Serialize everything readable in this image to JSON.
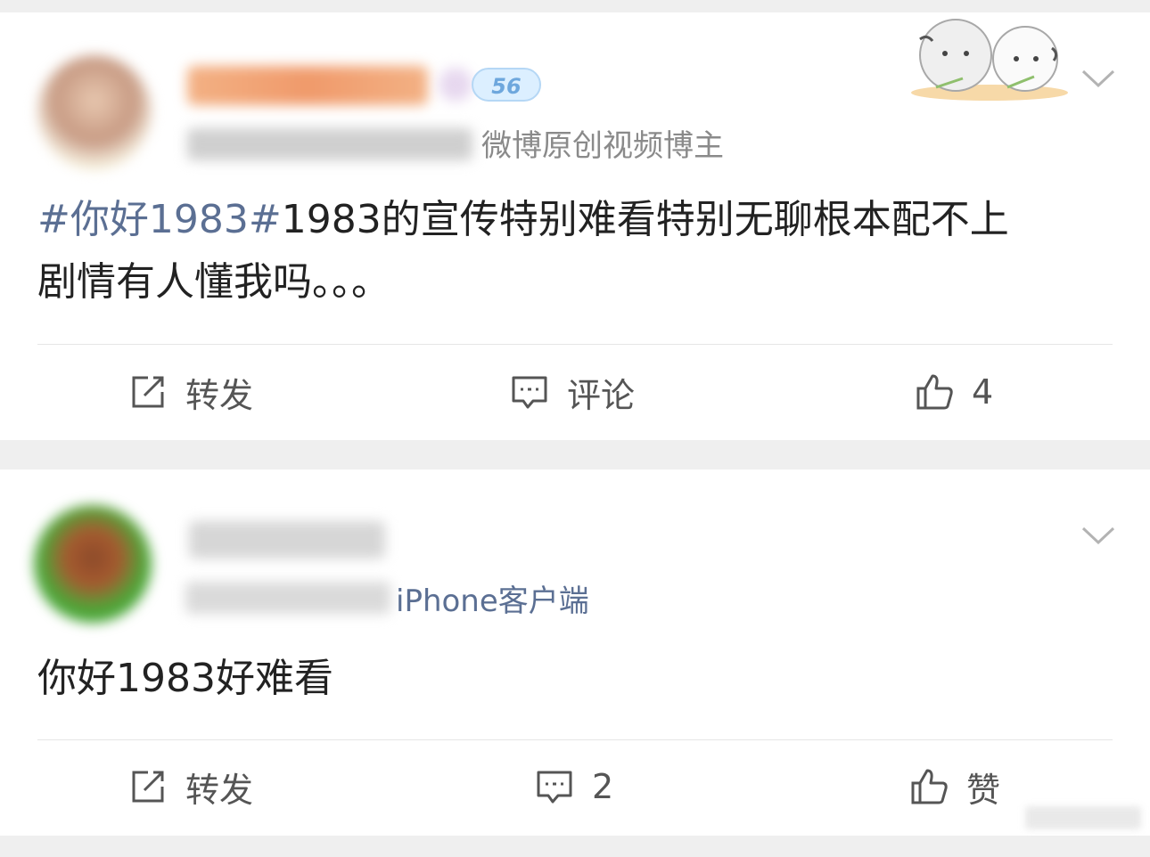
{
  "posts": [
    {
      "author_meta_suffix": "微博原创视频博主",
      "badge": "56",
      "text_hashtag": "#你好1983#",
      "text_line1": "1983的宣传特别难看特别无聊根本配不上",
      "text_line2": "剧情有人懂我吗。。。",
      "actions": {
        "repost": "转发",
        "comment": "评论",
        "like": "4"
      }
    },
    {
      "source_suffix": "iPhone客户端",
      "text": "你好1983好难看",
      "actions": {
        "repost": "转发",
        "comment": "2",
        "like": "赞"
      }
    }
  ],
  "icons": [
    "repost-icon",
    "comment-icon",
    "like-icon",
    "chevron-down-icon"
  ],
  "colors": {
    "link": "#5b6f93",
    "text": "#222222",
    "icon": "#555555",
    "background": "#efefef"
  }
}
